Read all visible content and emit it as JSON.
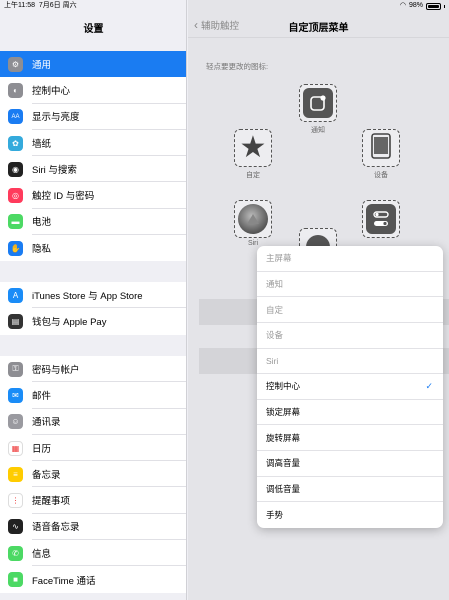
{
  "status": {
    "time": "上午11:58",
    "date": "7月6日 周六",
    "wifi": "wifi-icon",
    "battery": "98%"
  },
  "sidebar": {
    "title": "设置",
    "groups": [
      [
        {
          "label": "通用",
          "icon": "gear-icon",
          "color": "#8e8e93",
          "selected": true
        },
        {
          "label": "控制中心",
          "icon": "switches-icon",
          "color": "#8e8e93"
        },
        {
          "label": "显示与亮度",
          "icon": "aa-icon",
          "color": "#1a7cf2"
        },
        {
          "label": "墙纸",
          "icon": "flower-icon",
          "color": "#34aadc"
        },
        {
          "label": "Siri 与搜索",
          "icon": "siri-icon",
          "color": "#222"
        },
        {
          "label": "触控 ID 与密码",
          "icon": "fingerprint-icon",
          "color": "#ff3b5c"
        },
        {
          "label": "电池",
          "icon": "battery-icon",
          "color": "#4cd964"
        },
        {
          "label": "隐私",
          "icon": "hand-icon",
          "color": "#1a7cf2"
        }
      ],
      [
        {
          "label": "iTunes Store 与 App Store",
          "icon": "appstore-icon",
          "color": "#1a8cf7"
        },
        {
          "label": "钱包与 Apple Pay",
          "icon": "wallet-icon",
          "color": "#333"
        }
      ],
      [
        {
          "label": "密码与帐户",
          "icon": "key-icon",
          "color": "#8e8e93"
        },
        {
          "label": "邮件",
          "icon": "mail-icon",
          "color": "#1a8cf7"
        },
        {
          "label": "通讯录",
          "icon": "contacts-icon",
          "color": "#9a9aa0"
        },
        {
          "label": "日历",
          "icon": "calendar-icon",
          "color": "#ffffff"
        },
        {
          "label": "备忘录",
          "icon": "notes-icon",
          "color": "#ffcc00"
        },
        {
          "label": "提醒事项",
          "icon": "reminders-icon",
          "color": "#ffffff"
        },
        {
          "label": "语音备忘录",
          "icon": "voice-memo-icon",
          "color": "#222"
        },
        {
          "label": "信息",
          "icon": "messages-icon",
          "color": "#4cd964"
        },
        {
          "label": "FaceTime 通话",
          "icon": "facetime-icon",
          "color": "#4cd964"
        }
      ]
    ]
  },
  "detail": {
    "back_label": "辅助触控",
    "title": "自定顶层菜单",
    "hint": "轻点要更改的图标:",
    "slots": [
      {
        "label": "通知",
        "icon": "notification-icon"
      },
      {
        "label": "自定",
        "icon": "star-icon"
      },
      {
        "label": "设备",
        "icon": "ipad-icon"
      },
      {
        "label": "Siri",
        "icon": "siri-icon"
      },
      {
        "label": "",
        "icon": "control-center-icon"
      },
      {
        "label": "",
        "icon": "home-icon"
      }
    ]
  },
  "popover": {
    "items": [
      {
        "label": "主屏幕",
        "enabled": false,
        "checked": false
      },
      {
        "label": "通知",
        "enabled": false,
        "checked": false
      },
      {
        "label": "自定",
        "enabled": false,
        "checked": false
      },
      {
        "label": "设备",
        "enabled": false,
        "checked": false
      },
      {
        "label": "Siri",
        "enabled": false,
        "checked": false
      },
      {
        "label": "控制中心",
        "enabled": true,
        "checked": true
      },
      {
        "label": "锁定屏幕",
        "enabled": true,
        "checked": false
      },
      {
        "label": "旋转屏幕",
        "enabled": true,
        "checked": false
      },
      {
        "label": "调高音量",
        "enabled": true,
        "checked": false
      },
      {
        "label": "调低音量",
        "enabled": true,
        "checked": false
      },
      {
        "label": "手势",
        "enabled": true,
        "checked": false
      }
    ]
  },
  "accent_color": "#1a7cf2"
}
